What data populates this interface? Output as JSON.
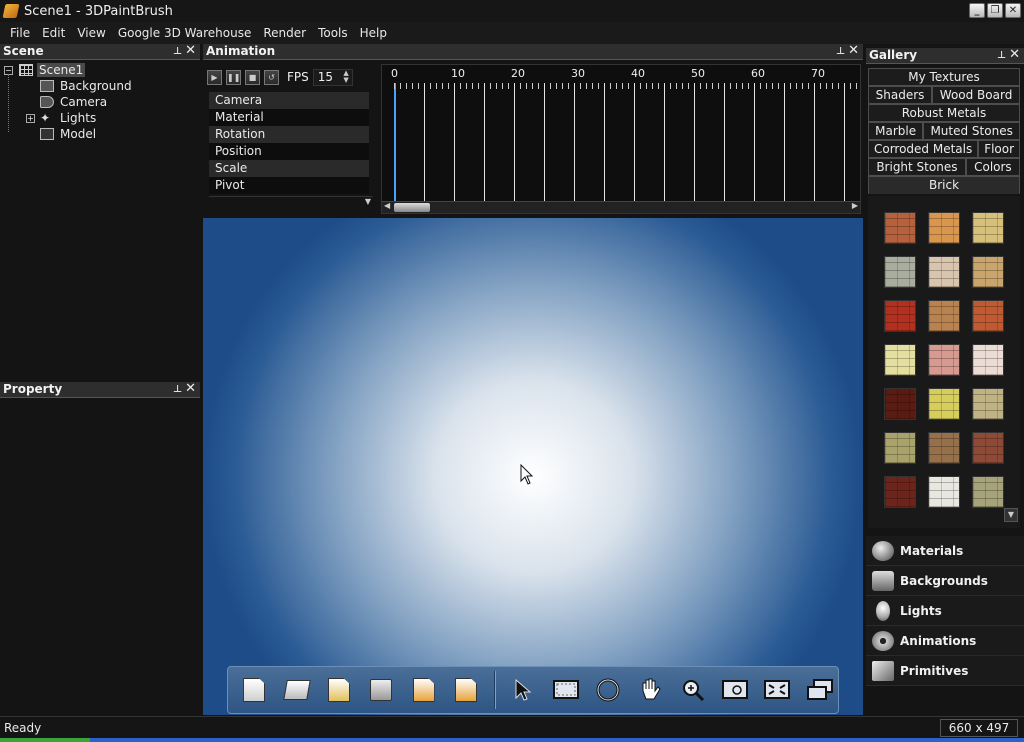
{
  "window": {
    "title": "Scene1 - 3DPaintBrush"
  },
  "menu": [
    "File",
    "Edit",
    "View",
    "Google 3D Warehouse",
    "Render",
    "Tools",
    "Help"
  ],
  "scene_panel": {
    "title": "Scene",
    "root": "Scene1",
    "children": [
      "Background",
      "Camera",
      "Lights",
      "Model"
    ]
  },
  "property_panel": {
    "title": "Property"
  },
  "animation": {
    "title": "Animation",
    "fps_label": "FPS",
    "fps_value": "15",
    "tracks": [
      "Camera",
      "Material",
      "Rotation",
      "Position",
      "Scale",
      "Pivot"
    ],
    "timeline_labels": [
      "0",
      "10",
      "20",
      "30",
      "40",
      "50",
      "60",
      "70"
    ]
  },
  "gallery": {
    "title": "Gallery",
    "tab_rows": [
      [
        "My Textures"
      ],
      [
        "Shaders",
        "Wood Board"
      ],
      [
        "Robust Metals"
      ],
      [
        "Marble",
        "Muted Stones"
      ],
      [
        "Corroded Metals",
        "Floor"
      ],
      [
        "Bright Stones",
        "Colors"
      ],
      [
        "Brick"
      ]
    ],
    "active_tab": "Brick",
    "swatch_colors": [
      "#b5613d",
      "#d9964f",
      "#d6c07a",
      "#a9ad9d",
      "#d9c5ad",
      "#c9a46c",
      "#b1301f",
      "#b9834f",
      "#c05a32",
      "#e4df9e",
      "#d69a90",
      "#ecdcd4",
      "#5a1c12",
      "#d7cd5c",
      "#bfb283",
      "#a9a36b",
      "#96704a",
      "#8e4a36",
      "#6d241a",
      "#e8e8e0",
      "#a6a27a"
    ]
  },
  "categories": [
    "Materials",
    "Backgrounds",
    "Lights",
    "Animations",
    "Primitives"
  ],
  "toolbar": {
    "tools": [
      "new-icon",
      "open-icon",
      "import-icon",
      "save-icon",
      "undo-icon",
      "redo-icon",
      "select-icon",
      "region-select-icon",
      "rotate-icon",
      "pan-icon",
      "zoom-icon",
      "zoom-region-icon",
      "fit-icon",
      "fullscreen-icon"
    ]
  },
  "status": {
    "text": "Ready",
    "size": "660 x 497"
  }
}
